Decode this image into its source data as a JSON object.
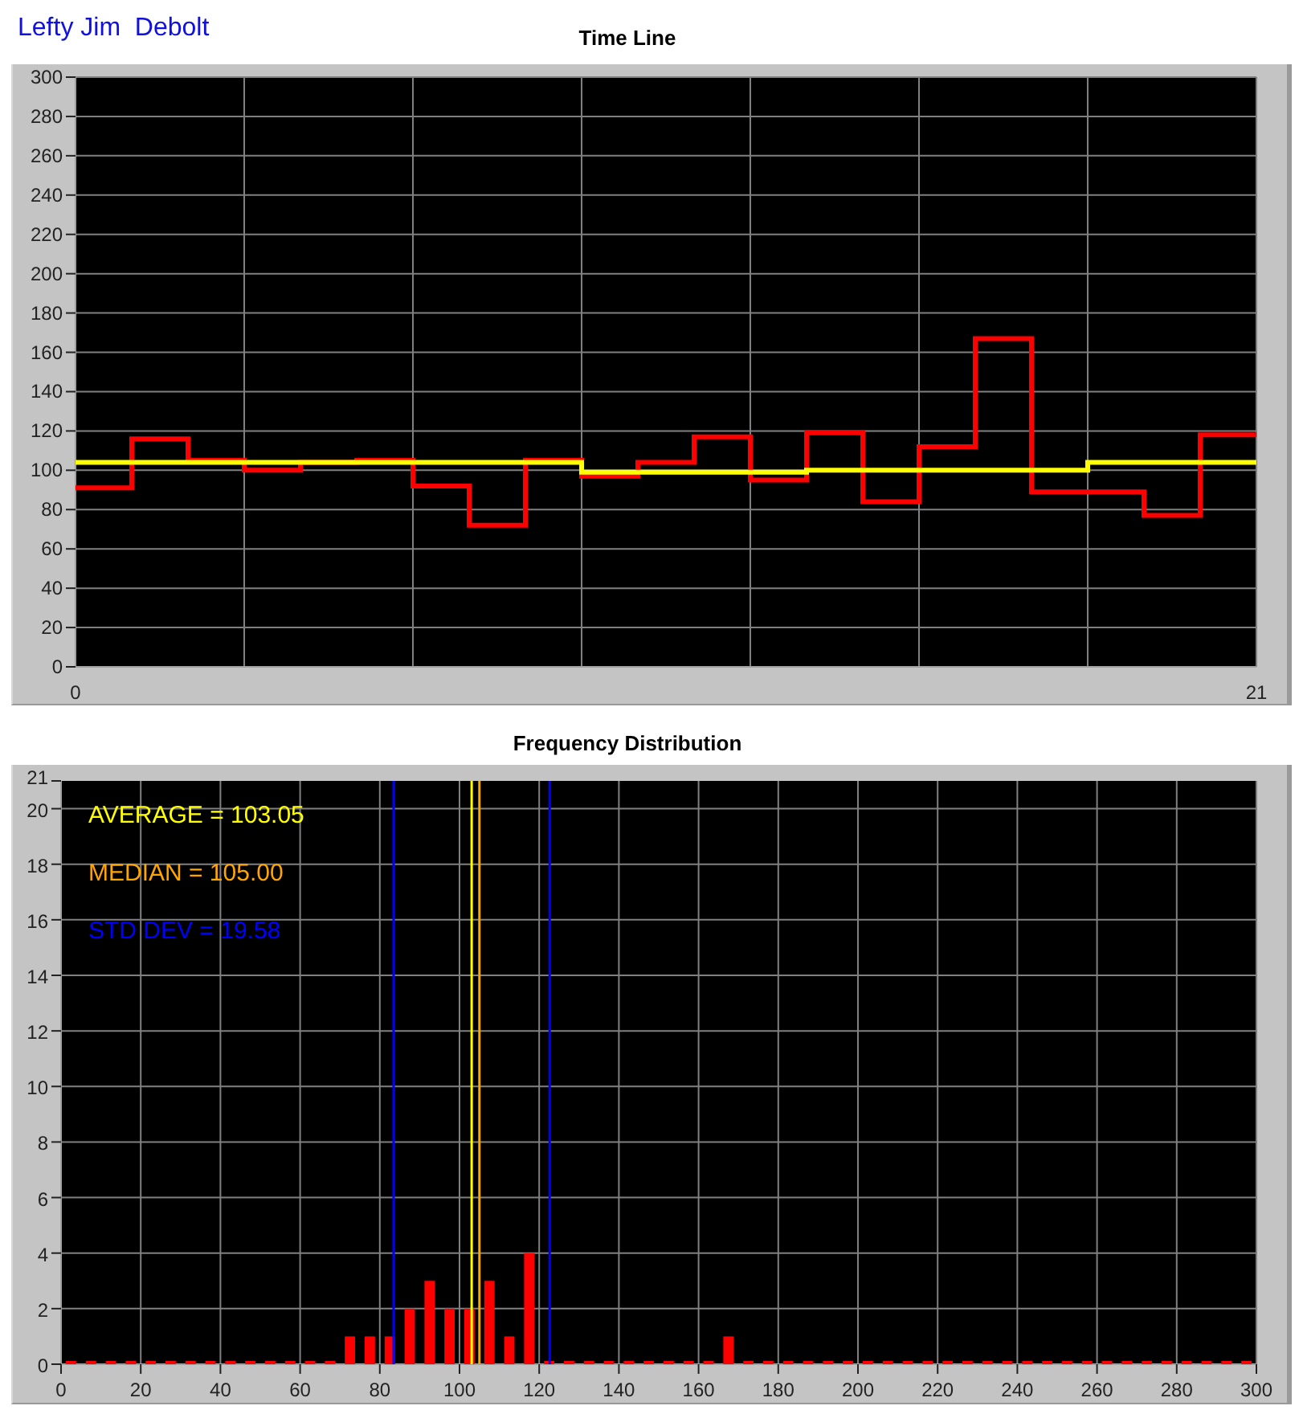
{
  "user_name": "Lefty Jim  Debolt",
  "time_line": {
    "chart_data": {
      "type": "line",
      "title": "Time Line",
      "x": [
        0,
        1,
        1,
        2,
        2,
        3,
        3,
        4,
        4,
        5,
        5,
        6,
        6,
        7,
        7,
        8,
        8,
        9,
        9,
        10,
        10,
        11,
        11,
        12,
        12,
        13,
        13,
        14,
        14,
        15,
        15,
        16,
        16,
        17,
        17,
        18,
        18,
        19,
        19,
        20,
        20,
        21
      ],
      "xlim": [
        0,
        21
      ],
      "ylim": [
        0,
        300
      ],
      "xticks": [
        0,
        21
      ],
      "yticks": [
        0,
        20,
        40,
        60,
        80,
        100,
        120,
        140,
        160,
        180,
        200,
        220,
        240,
        260,
        280,
        300
      ],
      "grid": true,
      "series": [
        {
          "color": "#ff0000",
          "values": [
            91,
            91,
            116,
            116,
            105,
            105,
            100,
            100,
            104,
            104,
            105,
            105,
            92,
            92,
            72,
            72,
            105,
            105,
            97,
            97,
            104,
            104,
            117,
            117,
            95,
            95,
            119,
            119,
            84,
            84,
            112,
            112,
            167,
            167,
            89,
            89,
            89,
            89,
            77,
            77,
            118,
            118
          ]
        },
        {
          "color": "#ffff00",
          "values": [
            104,
            104,
            104,
            104,
            104,
            104,
            104,
            104,
            104,
            104,
            104,
            104,
            104,
            104,
            104,
            104,
            104,
            104,
            99,
            99,
            99,
            99,
            99,
            99,
            99,
            99,
            100,
            100,
            100,
            100,
            100,
            100,
            100,
            100,
            100,
            100,
            104,
            104,
            104,
            104,
            104,
            104
          ]
        }
      ]
    }
  },
  "frequency_distribution": {
    "chart_data": {
      "type": "bar",
      "title": "Frequency Distribution",
      "x": [
        2.5,
        7.5,
        12.5,
        17.5,
        22.5,
        27.5,
        32.5,
        37.5,
        42.5,
        47.5,
        52.5,
        57.5,
        62.5,
        67.5,
        72.5,
        77.5,
        82.5,
        87.5,
        92.5,
        97.5,
        102.5,
        107.5,
        112.5,
        117.5,
        122.5,
        127.5,
        132.5,
        137.5,
        142.5,
        147.5,
        152.5,
        157.5,
        162.5,
        167.5,
        172.5,
        177.5,
        182.5,
        187.5,
        192.5,
        197.5,
        202.5,
        207.5,
        212.5,
        217.5,
        222.5,
        227.5,
        232.5,
        237.5,
        242.5,
        247.5,
        252.5,
        257.5,
        262.5,
        267.5,
        272.5,
        277.5,
        282.5,
        287.5,
        292.5,
        297.5
      ],
      "xlim": [
        0,
        300
      ],
      "ylim": [
        0,
        21
      ],
      "xticks": [
        0,
        20,
        40,
        60,
        80,
        100,
        120,
        140,
        160,
        180,
        200,
        220,
        240,
        260,
        280,
        300
      ],
      "yticks": [
        0,
        2,
        4,
        6,
        8,
        10,
        12,
        14,
        16,
        18,
        20,
        21
      ],
      "grid": true,
      "series": [
        {
          "color": "#ff0000",
          "values": [
            0,
            0,
            0,
            0,
            0,
            0,
            0,
            0,
            0,
            0,
            0,
            0,
            0,
            0,
            1,
            1,
            1,
            2,
            3,
            2,
            2,
            3,
            1,
            4,
            0,
            0,
            0,
            0,
            0,
            0,
            0,
            0,
            0,
            1,
            0,
            0,
            0,
            0,
            0,
            0,
            0,
            0,
            0,
            0,
            0,
            0,
            0,
            0,
            0,
            0,
            0,
            0,
            0,
            0,
            0,
            0,
            0,
            0,
            0,
            0
          ]
        }
      ],
      "ref_lines": [
        {
          "axis": "x",
          "value": 83.47,
          "color": "#0000ff"
        },
        {
          "axis": "x",
          "value": 122.63,
          "color": "#0000ff"
        },
        {
          "axis": "x",
          "value": 103.05,
          "color": "#ffff00"
        },
        {
          "axis": "x",
          "value": 105,
          "color": "#ffa500"
        }
      ]
    },
    "stats": [
      {
        "text": "AVERAGE = 103.05",
        "color": "#ffff00"
      },
      {
        "text": "MEDIAN = 105.00",
        "color": "#ffa500"
      },
      {
        "text": "STD DEV = 19.58",
        "color": "#0000ff"
      }
    ]
  }
}
